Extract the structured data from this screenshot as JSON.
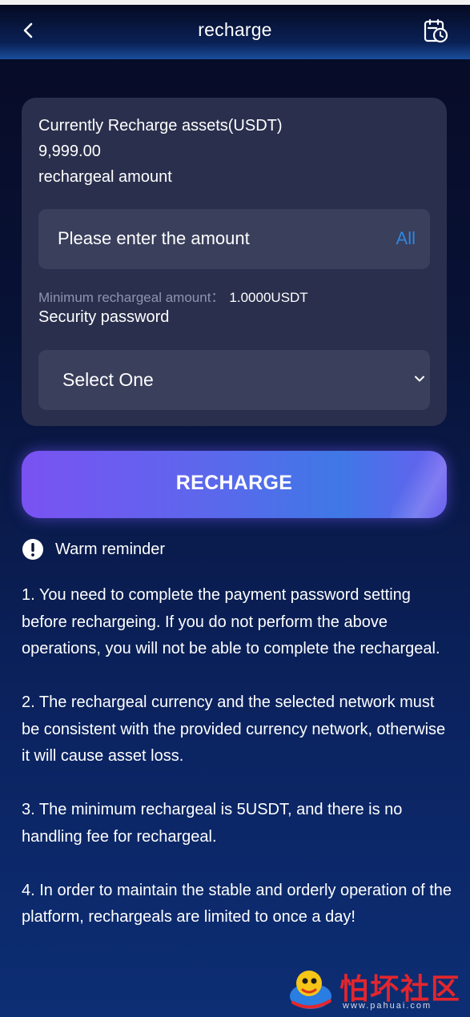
{
  "header": {
    "title": "recharge",
    "back_icon": "chevron-left-icon",
    "history_icon": "history-clock-icon"
  },
  "card": {
    "assets_label": "Currently Recharge assets(USDT)",
    "assets_value": "9,999.00",
    "amount_label": "rechargeal amount",
    "amount_placeholder": "Please enter the amount",
    "all_label": "All",
    "min_label": "Minimum rechargeal amount：",
    "min_value": "1.0000USDT",
    "password_label": "Security password",
    "password_select_value": "Select One"
  },
  "action": {
    "recharge_label": "RECHARGE"
  },
  "reminder": {
    "title": "Warm reminder",
    "items": [
      "1. You need to complete the payment password setting before rechargeing. If you do not perform the above operations, you will not be able to complete the rechargeal.",
      "2. The rechargeal currency and the selected network must be consistent with the provided currency network, otherwise it will cause asset loss.",
      "3. The minimum rechargeal is 5USDT, and there is no handling fee for rechargeal.",
      "4. In order to maintain the stable and orderly operation of the platform, rechargeals are limited to once a day!"
    ]
  },
  "watermark": {
    "site_name": "怕坏社区",
    "site_url": "www.pahuai.com"
  },
  "colors": {
    "accent_blue": "#2f86e0",
    "card_bg": "#2a2f4d",
    "input_bg": "#3a3f5c",
    "button_start": "#7a52f2",
    "button_end": "#3f78e6"
  }
}
